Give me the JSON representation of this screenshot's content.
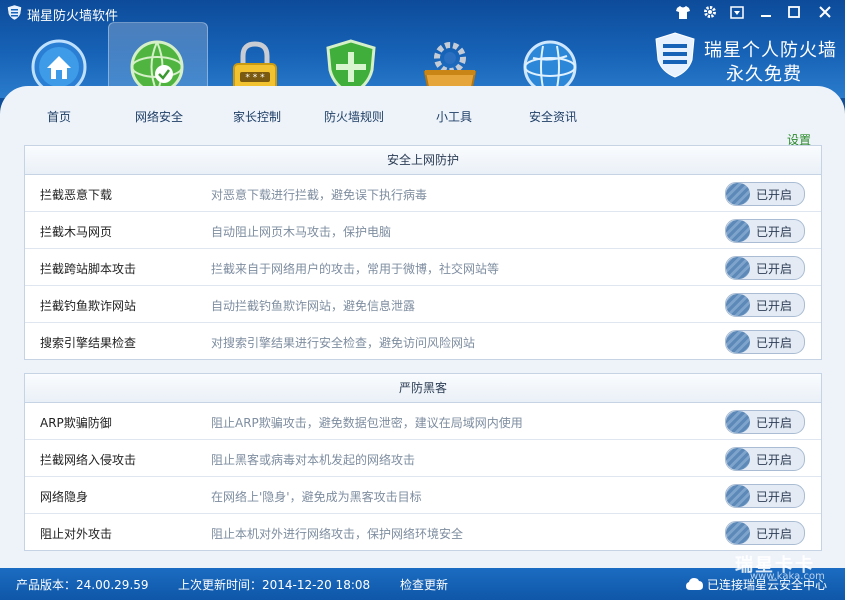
{
  "window": {
    "title": "瑞星防火墙软件"
  },
  "brand": {
    "line1": "瑞星个人防火墙",
    "line2": "永久免费"
  },
  "nav": [
    {
      "label": "首页",
      "icon": "home-icon"
    },
    {
      "label": "网络安全",
      "icon": "network-globe-icon",
      "active": true
    },
    {
      "label": "家长控制",
      "icon": "lock-icon"
    },
    {
      "label": "防火墙规则",
      "icon": "shield-icon"
    },
    {
      "label": "小工具",
      "icon": "toolbox-gear-icon"
    },
    {
      "label": "安全资讯",
      "icon": "info-globe-icon"
    }
  ],
  "settings_label": "设置",
  "sections": [
    {
      "title": "安全上网防护",
      "rows": [
        {
          "label": "拦截恶意下载",
          "desc": "对恶意下载进行拦截，避免误下执行病毒",
          "status": "已开启"
        },
        {
          "label": "拦截木马网页",
          "desc": "自动阻止网页木马攻击，保护电脑",
          "status": "已开启"
        },
        {
          "label": "拦截跨站脚本攻击",
          "desc": "拦截来自于网络用户的攻击，常用于微博，社交网站等",
          "status": "已开启"
        },
        {
          "label": "拦截钓鱼欺诈网站",
          "desc": "自动拦截钓鱼欺诈网站，避免信息泄露",
          "status": "已开启"
        },
        {
          "label": "搜索引擎结果检查",
          "desc": "对搜索引擎结果进行安全检查，避免访问风险网站",
          "status": "已开启"
        }
      ]
    },
    {
      "title": "严防黑客",
      "rows": [
        {
          "label": "ARP欺骗防御",
          "desc": "阻止ARP欺骗攻击，避免数据包泄密，建议在局域网内使用",
          "status": "已开启"
        },
        {
          "label": "拦截网络入侵攻击",
          "desc": "阻止黑客或病毒对本机发起的网络攻击",
          "status": "已开启"
        },
        {
          "label": "网络隐身",
          "desc": "在网络上'隐身'，避免成为黑客攻击目标",
          "status": "已开启"
        },
        {
          "label": "阻止对外攻击",
          "desc": "阻止本机对外进行网络攻击，保护网络环境安全",
          "status": "已开启"
        }
      ]
    }
  ],
  "status": {
    "version": "产品版本：24.00.29.59",
    "last_update": "上次更新时间：2014-12-20 18:08",
    "check_update": "检查更新",
    "cloud": "已连接瑞星云安全中心"
  },
  "watermark": {
    "text": "瑞星卡卡",
    "url": "www.kaka.com"
  },
  "colors": {
    "header": "#1763b7",
    "content_bg": "#eef3fa",
    "accent_green": "#2b8a2b"
  }
}
